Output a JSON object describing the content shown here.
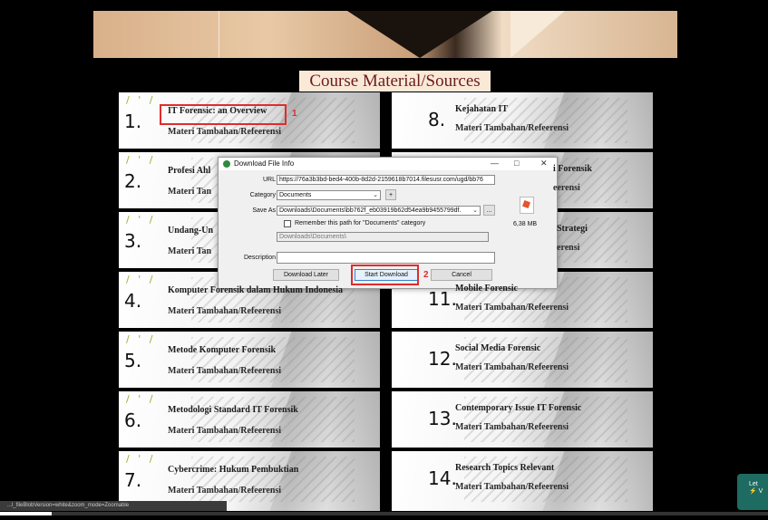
{
  "heading": "Course Material/Sources",
  "left_items": [
    {
      "num": "1.",
      "title": "IT Forensic: an Overview",
      "sub": "Materi Tambahan/Refeerensi"
    },
    {
      "num": "2.",
      "title": "Profesi Ahl",
      "sub": "Materi Tan"
    },
    {
      "num": "3.",
      "title": "Undang-Un",
      "sub": "Materi Tan"
    },
    {
      "num": "4.",
      "title": "Komputer Forensik dalam Hukum Indonesia",
      "sub": "Materi Tambahan/Refeerensi"
    },
    {
      "num": "5.",
      "title": "Metode Komputer Forensik",
      "sub": "Materi Tambahan/Refeerensi"
    },
    {
      "num": "6.",
      "title": "Metodologi Standard IT Forensik",
      "sub": "Materi Tambahan/Refeerensi"
    },
    {
      "num": "7.",
      "title": "Cybercrime: Hukum Pembuktian",
      "sub": "Materi Tambahan/Refeerensi"
    }
  ],
  "right_items": [
    {
      "num": "8.",
      "title": "Kejahatan IT",
      "sub": "Materi Tambahan/Refeerensi"
    },
    {
      "num": "",
      "title": "i Forensik",
      "sub": "eerensi"
    },
    {
      "num": "",
      "title": "Strategi",
      "sub": "erensi"
    },
    {
      "num": "11.",
      "title": "Mobile Forensic",
      "sub": "Materi Tambahan/Refeerensi"
    },
    {
      "num": "12.",
      "title": "Social Media Forensic",
      "sub": "Materi Tambahan/Refeerensi"
    },
    {
      "num": "13.",
      "title": "Contemporary Issue IT Forensic",
      "sub": "Materi Tambahan/Refeerensi"
    },
    {
      "num": "14.",
      "title": "Research Topics Relevant",
      "sub": "Materi Tambahan/Refeerensi"
    }
  ],
  "annotations": {
    "label1": "1",
    "label2": "2",
    "color": "#e02c2c"
  },
  "dialog": {
    "title": "Download File Info",
    "minimize": "—",
    "maximize": "□",
    "close": "✕",
    "url_label": "URL",
    "url_value": "https://76a3b3bd-bed4-400b-8d2d-2159618b7014.filesusr.com/ugd/bb76",
    "category_label": "Category",
    "category_value": "Documents",
    "category_add": "+",
    "saveas_label": "Save As",
    "saveas_value": "Downloads\\Documents\\bb762f_eb03919b62d54ea9b9455799df.",
    "browse": "...",
    "remember_label": "Remember this path for \"Documents\" category",
    "path_hint": "Downloads\\Documents\\",
    "file_size": "6,38 MB",
    "description_label": "Description",
    "description_value": "",
    "btn_later": "Download Later",
    "btn_start": "Start Download",
    "btn_cancel": "Cancel"
  },
  "status_text": "...l_fileBlobVersion=white&zoom_mode=Zoomable",
  "progress_fraction": 0.067,
  "side_button": {
    "line1": "Let",
    "line2": "⚡ V"
  }
}
